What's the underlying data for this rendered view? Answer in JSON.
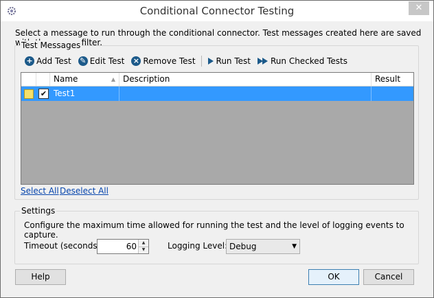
{
  "window": {
    "title": "Conditional Connector Testing",
    "close_glyph": "✕"
  },
  "intro_text": "Select a message to run through the conditional connector. Test messages created here are saved with the source filter.",
  "test_messages": {
    "group_title": "Test Messages",
    "toolbar": {
      "add_label": "Add Test",
      "edit_label": "Edit Test",
      "remove_label": "Remove Test",
      "run_label": "Run Test",
      "run_checked_label": "Run Checked Tests"
    },
    "grid": {
      "columns": [
        "Name",
        "Description",
        "Result"
      ],
      "rows": [
        {
          "checked": true,
          "check_glyph": "✔",
          "name": "Test1",
          "description": "",
          "result": ""
        }
      ]
    },
    "select_all": "Select All",
    "deselect_all": "Deselect All"
  },
  "settings": {
    "group_title": "Settings",
    "description": "Configure the maximum time allowed for running the test and the level of logging events to capture.",
    "timeout_label": "Timeout (seconds):",
    "timeout_value": "60",
    "logging_label": "Logging Level:",
    "logging_value": "Debug"
  },
  "buttons": {
    "help": "Help",
    "ok": "OK",
    "cancel": "Cancel"
  },
  "colors": {
    "selection": "#3399ff",
    "grid_background": "#a9a9a9",
    "toolbar_icon": "#1c5a8a"
  }
}
